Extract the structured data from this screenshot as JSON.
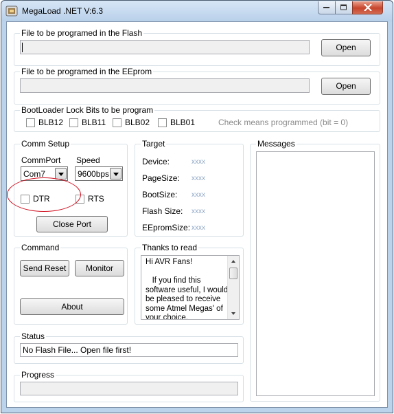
{
  "window": {
    "title": "MegaLoad .NET V:6.3",
    "icon": "megaload-app-icon"
  },
  "flash": {
    "group_label": "File to be programed in the Flash",
    "file_value": "",
    "open_label": "Open"
  },
  "eeprom": {
    "group_label": "File to be programed in the EEprom",
    "file_value": "",
    "open_label": "Open"
  },
  "lockbits": {
    "group_label": "BootLoader Lock Bits to be program",
    "bits": [
      {
        "label": "BLB12",
        "checked": false
      },
      {
        "label": "BLB11",
        "checked": false
      },
      {
        "label": "BLB02",
        "checked": false
      },
      {
        "label": "BLB01",
        "checked": false
      }
    ],
    "hint": "Check means programmed (bit = 0)"
  },
  "comm": {
    "group_label": "Comm Setup",
    "port_label": "CommPort",
    "port_value": "Com7",
    "speed_label": "Speed",
    "speed_value": "9600bps",
    "dtr_label": "DTR",
    "rts_label": "RTS",
    "close_port_label": "Close Port"
  },
  "target": {
    "group_label": "Target",
    "fields": [
      {
        "label": "Device:",
        "value": "xxxx"
      },
      {
        "label": "PageSize:",
        "value": "xxxx"
      },
      {
        "label": "BootSize:",
        "value": "xxxx"
      },
      {
        "label": "Flash Size:",
        "value": "xxxx"
      },
      {
        "label": "EEpromSize:",
        "value": "xxxx"
      }
    ]
  },
  "messages": {
    "group_label": "Messages"
  },
  "command": {
    "group_label": "Command",
    "send_reset_label": "Send Reset",
    "monitor_label": "Monitor",
    "about_label": "About"
  },
  "thanks": {
    "group_label": "Thanks to read",
    "text": "Hi AVR Fans!\n\n   If you find this software useful, I would be pleased to receive some Atmel Megas' of your choice."
  },
  "status": {
    "group_label": "Status",
    "value": "No Flash File...  Open file first!"
  },
  "progress": {
    "group_label": "Progress",
    "percent": 0
  },
  "colors": {
    "annotation_oval": "#d01020",
    "target_value": "#8fa7c6"
  }
}
